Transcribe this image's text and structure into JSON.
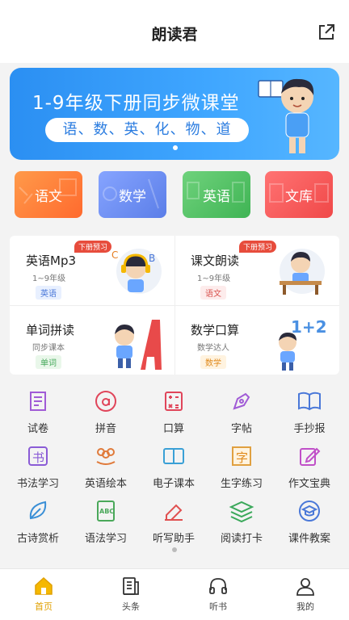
{
  "header": {
    "title": "朗读君",
    "share_icon": "share-icon"
  },
  "banner": {
    "title": "1-9年级下册同步微课堂",
    "subtitle": "语、数、英、化、物、道"
  },
  "subjects": [
    {
      "label": "语文",
      "color": "#ff7a3d"
    },
    {
      "label": "数学",
      "color": "#6f8ff0"
    },
    {
      "label": "英语",
      "color": "#59c36a"
    },
    {
      "label": "文库",
      "color": "#f65a5a"
    }
  ],
  "cards": [
    {
      "title": "英语Mp3",
      "subtitle": "1~9年级",
      "tag": "英语",
      "badge": "下册预习"
    },
    {
      "title": "课文朗读",
      "subtitle": "1~9年级",
      "tag": "语文",
      "badge": "下册预习"
    },
    {
      "title": "单词拼读",
      "subtitle": "同步课本",
      "tag": "单词",
      "badge": ""
    },
    {
      "title": "数学口算",
      "subtitle": "数学达人",
      "tag": "数学",
      "badge": ""
    }
  ],
  "tools": [
    {
      "label": "试卷",
      "icon": "exam-scroll-icon"
    },
    {
      "label": "拼音",
      "icon": "pinyin-a-icon"
    },
    {
      "label": "口算",
      "icon": "calculator-icon"
    },
    {
      "label": "字帖",
      "icon": "pen-nib-icon"
    },
    {
      "label": "手抄报",
      "icon": "open-book-icon"
    },
    {
      "label": "书法学习",
      "icon": "calligraphy-icon"
    },
    {
      "label": "英语绘本",
      "icon": "flower-book-icon"
    },
    {
      "label": "电子课本",
      "icon": "ebook-icon"
    },
    {
      "label": "生字练习",
      "icon": "character-grid-icon"
    },
    {
      "label": "作文宝典",
      "icon": "edit-document-icon"
    },
    {
      "label": "古诗赏析",
      "icon": "leaf-icon"
    },
    {
      "label": "语法学习",
      "icon": "abc-document-icon"
    },
    {
      "label": "听写助手",
      "icon": "eraser-pen-icon"
    },
    {
      "label": "阅读打卡",
      "icon": "layers-icon"
    },
    {
      "label": "课件教案",
      "icon": "graduation-cap-icon"
    }
  ],
  "tabs": [
    {
      "label": "首页",
      "icon": "home-icon",
      "active": true
    },
    {
      "label": "头条",
      "icon": "news-icon",
      "active": false
    },
    {
      "label": "听书",
      "icon": "headphones-icon",
      "active": false
    },
    {
      "label": "我的",
      "icon": "profile-icon",
      "active": false
    }
  ],
  "colors": {
    "accent_orange": "#f5a623",
    "banner_blue": "#3a9bf8",
    "badge_red": "#e74c3c"
  }
}
